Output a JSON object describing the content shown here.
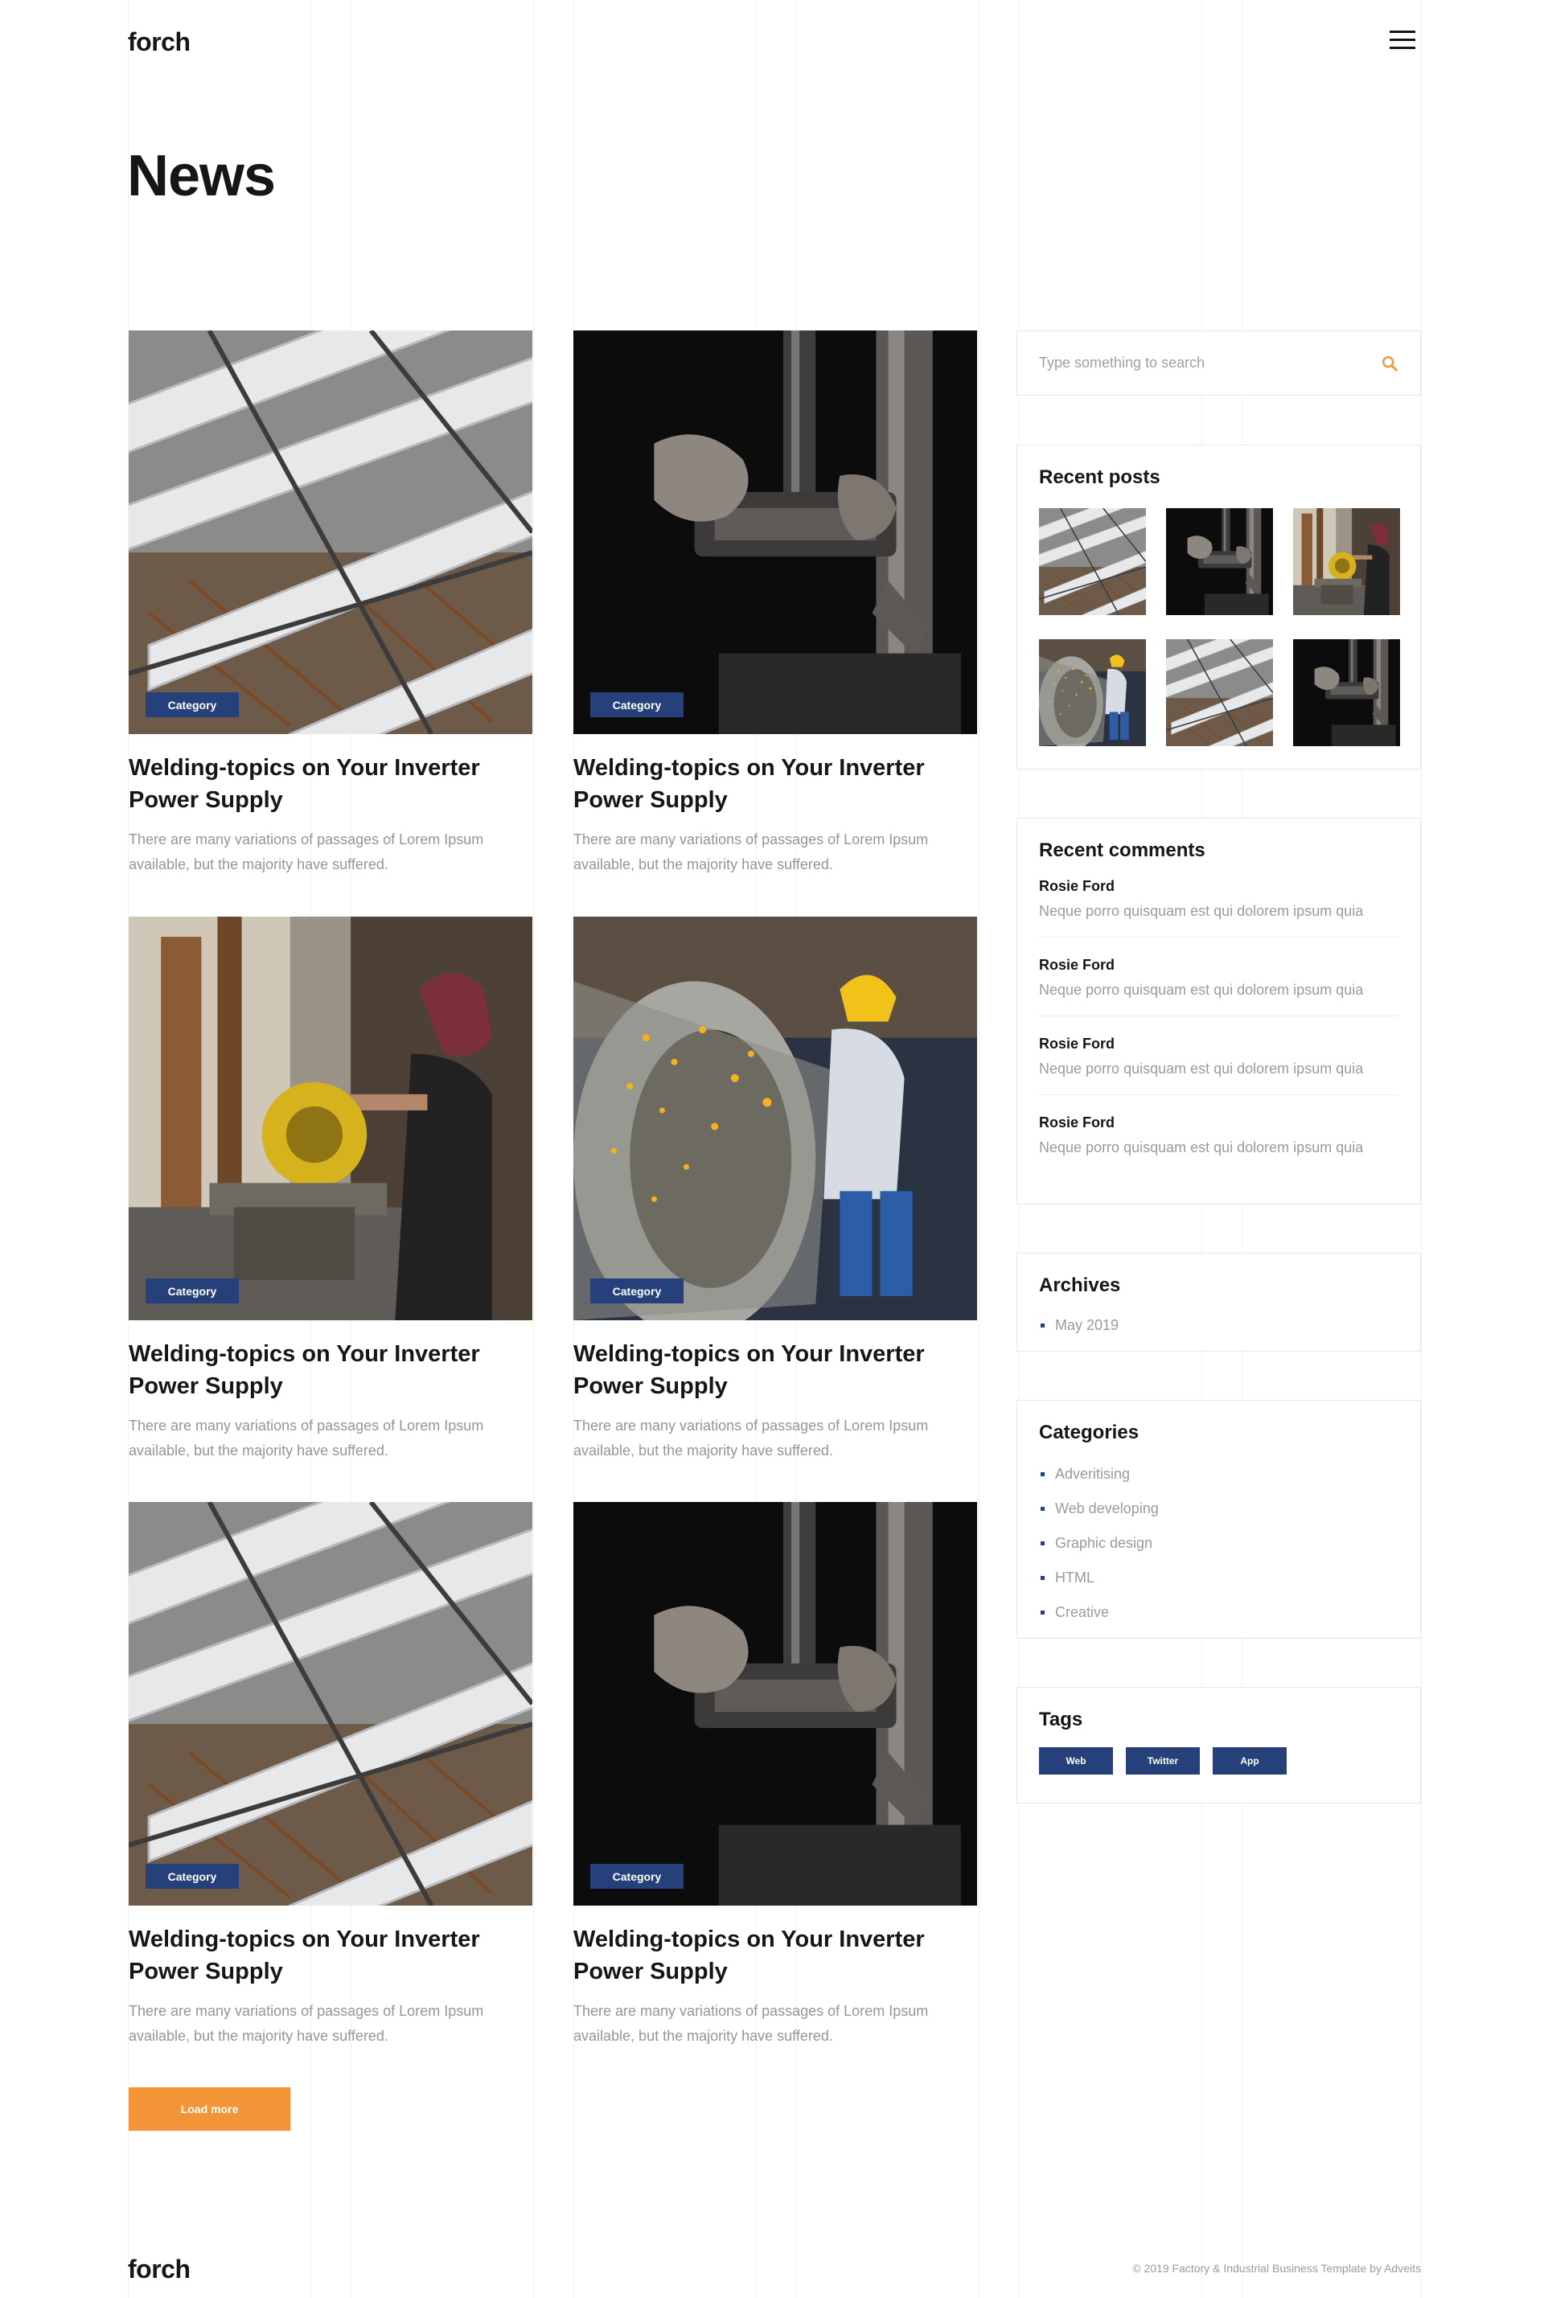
{
  "brand": {
    "logo": "forch"
  },
  "page": {
    "title": "News"
  },
  "posts": [
    {
      "category": "Category",
      "title": "Welding-topics on Your Inverter Power Supply",
      "excerpt": "There are many variations of passages of Lorem Ipsum available, but the majority have suffered.",
      "image": "pipes-aerial"
    },
    {
      "category": "Category",
      "title": "Welding-topics on Your Inverter Power Supply",
      "excerpt": "There are many variations of passages of Lorem Ipsum available, but the majority have suffered.",
      "image": "drill-press"
    },
    {
      "category": "Category",
      "title": "Welding-topics on Your Inverter Power Supply",
      "excerpt": "There are many variations of passages of Lorem Ipsum available, but the majority have suffered.",
      "image": "chop-saw-worker"
    },
    {
      "category": "Category",
      "title": "Welding-topics on Your Inverter Power Supply",
      "excerpt": "There are many variations of passages of Lorem Ipsum available, but the majority have suffered.",
      "image": "grinder-sparks-pipe"
    },
    {
      "category": "Category",
      "title": "Welding-topics on Your Inverter Power Supply",
      "excerpt": "There are many variations of passages of Lorem Ipsum available, but the majority have suffered.",
      "image": "pipes-aerial"
    },
    {
      "category": "Category",
      "title": "Welding-topics on Your Inverter Power Supply",
      "excerpt": "There are many variations of passages of Lorem Ipsum available, but the majority have suffered.",
      "image": "drill-press"
    }
  ],
  "load_more": {
    "label": "Load more"
  },
  "sidebar": {
    "search": {
      "placeholder": "Type something to search",
      "icon": "search-icon"
    },
    "recent_posts": {
      "title": "Recent posts",
      "thumbs": [
        "pipes-aerial",
        "drill-press",
        "chop-saw-worker",
        "grinder-sparks-pipe",
        "pipes-aerial",
        "drill-press"
      ]
    },
    "recent_comments": {
      "title": "Recent comments",
      "items": [
        {
          "author": "Rosie Ford",
          "text": "Neque porro quisquam est qui dolorem ipsum quia"
        },
        {
          "author": "Rosie Ford",
          "text": "Neque porro quisquam est qui dolorem ipsum quia"
        },
        {
          "author": "Rosie Ford",
          "text": "Neque porro quisquam est qui dolorem ipsum quia"
        },
        {
          "author": "Rosie Ford",
          "text": "Neque porro quisquam est qui dolorem ipsum quia"
        }
      ]
    },
    "archives": {
      "title": "Archives",
      "items": [
        "May 2019"
      ]
    },
    "categories": {
      "title": "Categories",
      "items": [
        "Adveritising",
        "Web developing",
        "Graphic design",
        "HTML",
        "Creative"
      ]
    },
    "tags": {
      "title": "Tags",
      "items": [
        "Web",
        "Twitter",
        "App"
      ]
    }
  },
  "footer": {
    "logo": "forch",
    "copyright": "© 2019 Factory & Industrial Business Template by Adveits"
  },
  "colors": {
    "accent": "#f39536",
    "badge": "#25407a",
    "text": "#161616",
    "muted": "#959595",
    "border": "#e6e6e6"
  }
}
